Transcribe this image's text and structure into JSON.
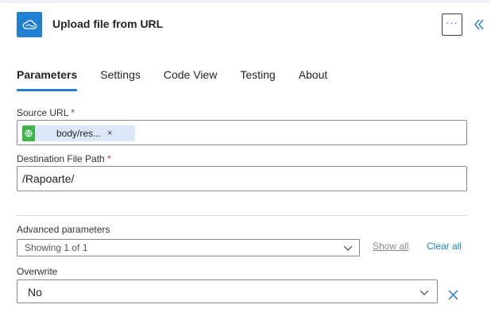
{
  "header": {
    "title": "Upload file from URL",
    "more_label": "···",
    "icon": "onedrive-cloud-icon",
    "accent": "#1f7fd1"
  },
  "tabs": [
    {
      "label": "Parameters",
      "active": true
    },
    {
      "label": "Settings",
      "active": false
    },
    {
      "label": "Code View",
      "active": false
    },
    {
      "label": "Testing",
      "active": false
    },
    {
      "label": "About",
      "active": false
    }
  ],
  "source_url": {
    "label": "Source URL",
    "required_mark": "*",
    "token_text": "body/res...",
    "token_remove": "×"
  },
  "destination": {
    "label": "Destination File Path",
    "required_mark": "*",
    "value": "/Rapoarte/"
  },
  "advanced": {
    "label": "Advanced parameters",
    "select_value": "Showing 1 of 1",
    "show_all": "Show all",
    "clear_all": "Clear all"
  },
  "overwrite": {
    "label": "Overwrite",
    "value": "No"
  }
}
